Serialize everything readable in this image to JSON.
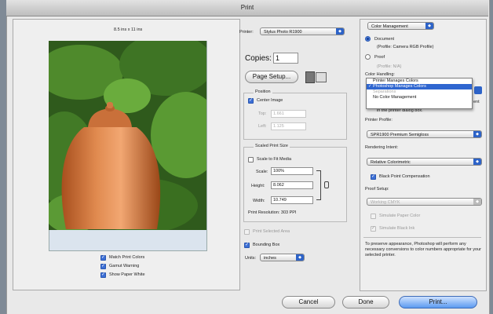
{
  "dialog": {
    "title": "Print"
  },
  "preview": {
    "paper_size": "8.5 ins x 11 ins"
  },
  "checks_left": [
    {
      "label": "Match Print Colors",
      "checked": true
    },
    {
      "label": "Gamut Warning",
      "checked": true
    },
    {
      "label": "Show Paper White",
      "checked": true
    }
  ],
  "printer": {
    "label": "Printer:",
    "value": "Stylus Photo R1900"
  },
  "copies": {
    "label": "Copies:",
    "value": "1"
  },
  "page_setup_label": "Page Setup...",
  "position": {
    "legend": "Position",
    "center_label": "Center Image",
    "top_label": "Top:",
    "top_value": "1.661",
    "left_label": "Left:",
    "left_value": "1.125"
  },
  "scaled": {
    "legend": "Scaled Print Size",
    "fit_label": "Scale to Fit Media",
    "scale_label": "Scale:",
    "scale_value": "100%",
    "height_label": "Height:",
    "height_value": "8.062",
    "width_label": "Width:",
    "width_value": "10.749",
    "resolution": "Print Resolution: 303 PPI"
  },
  "print_selected": "Print Selected Area",
  "bounding_box": "Bounding Box",
  "units": {
    "label": "Units:",
    "value": "inches"
  },
  "color_mgmt": {
    "section": "Color Management",
    "document_label": "Document",
    "document_profile": "(Profile: Camera RGB Profile)",
    "proof_label": "Proof",
    "proof_profile": "(Profile: N/A)",
    "color_handling": "Color Handling:",
    "menu_items": [
      "Printer Manages Colors",
      "Photoshop Manages Colors",
      "Separations",
      "No Color Management"
    ],
    "menu_check": "✓",
    "hidden_text_1": "ent",
    "hidden_text_2": "in the printer dialog box.",
    "printer_profile_label": "Printer Profile:",
    "printer_profile_value": "SPR1900 Premium Semigloss",
    "rendering_label": "Rendering Intent:",
    "rendering_value": "Relative Colorimetric",
    "bpc_label": "Black Point Compensation",
    "proof_setup_label": "Proof Setup:",
    "proof_setup_value": "Working CMYK",
    "sim_paper": "Simulate Paper Color",
    "sim_ink": "Simulate Black Ink",
    "note": "To preserve appearance, Photoshop will perform any necessary conversions to color numbers appropriate for your selected printer."
  },
  "buttons": {
    "cancel": "Cancel",
    "done": "Done",
    "print": "Print..."
  },
  "colors": {
    "accent": "#2f66d0",
    "default_button": "#5b9af0"
  }
}
